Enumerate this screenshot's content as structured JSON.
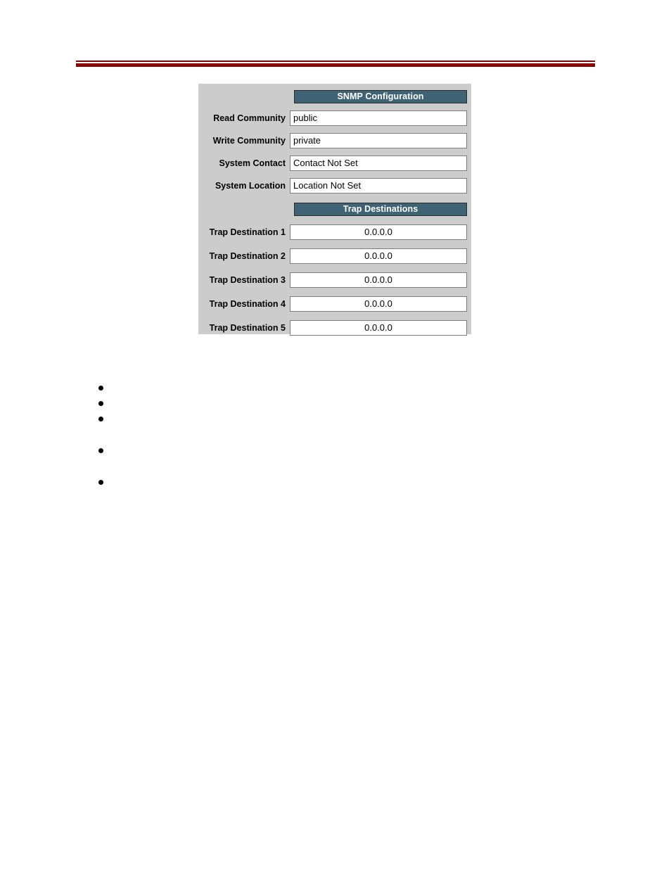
{
  "page": {
    "divider_color": "#8b0000",
    "panel_background": "#cccccc",
    "header_bar_color": "#3e6374",
    "header_text_color": "#ffffff"
  },
  "snmp_panel": {
    "sections": [
      {
        "title": "SNMP Configuration",
        "rows": [
          {
            "label": "Read Community",
            "value": "public",
            "align": "left"
          },
          {
            "label": "Write Community",
            "value": "private",
            "align": "left"
          },
          {
            "label": "System Contact",
            "value": "Contact Not Set",
            "align": "left"
          },
          {
            "label": "System Location",
            "value": "Location Not Set",
            "align": "left"
          }
        ]
      },
      {
        "title": "Trap Destinations",
        "rows": [
          {
            "label": "Trap Destination 1",
            "value": "0.0.0.0",
            "align": "center"
          },
          {
            "label": "Trap Destination 2",
            "value": "0.0.0.0",
            "align": "center"
          },
          {
            "label": "Trap Destination 3",
            "value": "0.0.0.0",
            "align": "center"
          },
          {
            "label": "Trap Destination 4",
            "value": "0.0.0.0",
            "align": "center"
          },
          {
            "label": "Trap Destination 5",
            "value": "0.0.0.0",
            "align": "center"
          }
        ]
      }
    ]
  },
  "bullets": [
    {
      "text": ""
    },
    {
      "text": ""
    },
    {
      "text": ""
    },
    {
      "text": ""
    },
    {
      "text": ""
    }
  ]
}
